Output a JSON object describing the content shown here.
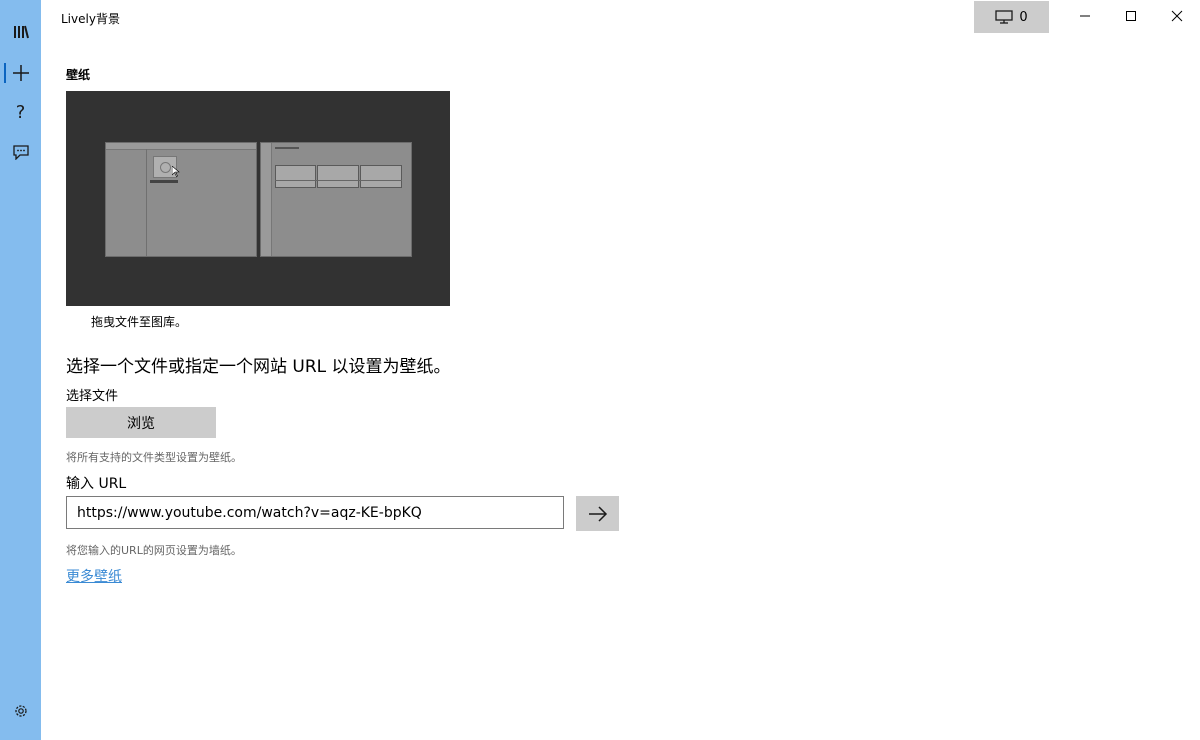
{
  "app": {
    "title": "Lively背景"
  },
  "titlebar": {
    "screen_count": "0"
  },
  "sidebar": {
    "items": [
      {
        "icon": "library-icon"
      },
      {
        "icon": "add-icon"
      },
      {
        "icon": "help-icon"
      },
      {
        "icon": "feedback-icon"
      }
    ],
    "settings_icon": "gear-icon"
  },
  "main": {
    "section_title": "壁纸",
    "preview_caption": "拖曳文件至图库。",
    "headline": "选择一个文件或指定一个网站 URL 以设置为壁纸。",
    "file": {
      "label": "选择文件",
      "browse_label": "浏览",
      "hint": "将所有支持的文件类型设置为壁纸。"
    },
    "url": {
      "label": "输入 URL",
      "value": "https://www.youtube.com/watch?v=aqz-KE-bpKQ",
      "hint": "将您输入的URL的网页设置为墙纸。"
    },
    "more_link": "更多壁纸"
  },
  "colors": {
    "sidebar": "#84bcee",
    "button": "#cccccc",
    "link": "#3a8ad4",
    "preview_bg": "#323232"
  }
}
